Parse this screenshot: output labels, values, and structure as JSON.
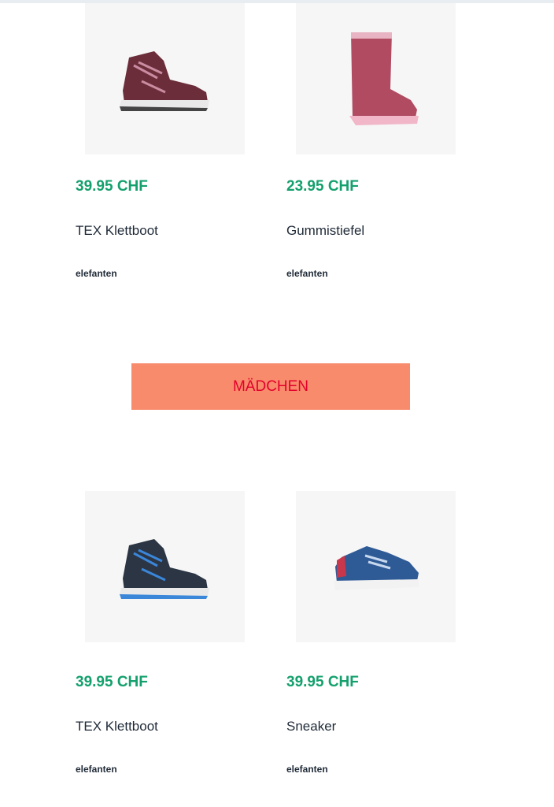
{
  "row1": [
    {
      "price": "39.95 CHF",
      "name": "TEX Klettboot",
      "brand": "elefanten",
      "icon": "boot-icon"
    },
    {
      "price": "23.95 CHF",
      "name": "Gummistiefel",
      "brand": "elefanten",
      "icon": "rain-boot-icon"
    }
  ],
  "section_button": {
    "label": "MÄDCHEN"
  },
  "row2": [
    {
      "price": "39.95 CHF",
      "name": "TEX Klettboot",
      "brand": "elefanten",
      "icon": "boot-icon"
    },
    {
      "price": "39.95 CHF",
      "name": "Sneaker",
      "brand": "elefanten",
      "icon": "sneaker-icon"
    }
  ],
  "colors": {
    "price": "#14a06d",
    "button_bg": "#f88b6c",
    "button_text": "#e4002b"
  }
}
